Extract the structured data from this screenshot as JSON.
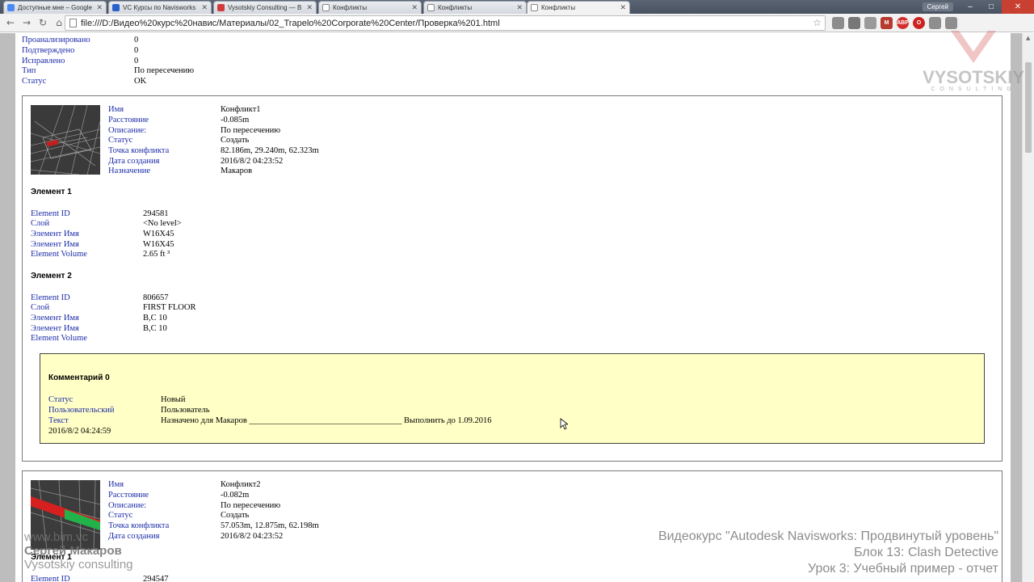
{
  "browser": {
    "tabs": [
      {
        "title": "Доступные мне – Google",
        "favicon_color": "#4a8af4",
        "active": false
      },
      {
        "title": "VC Курсы по Navisworks",
        "favicon_color": "#2a62c9",
        "active": false
      },
      {
        "title": "Vysotskiy Consulting — B",
        "favicon_color": "#d23b3b",
        "active": false
      },
      {
        "title": "Конфликты",
        "favicon_color": "#ffffff",
        "active": false
      },
      {
        "title": "Конфликты",
        "favicon_color": "#ffffff",
        "active": false
      },
      {
        "title": "Конфликты",
        "favicon_color": "#ffffff",
        "active": true
      }
    ],
    "user": "Сергей",
    "url": "file:///D:/Видео%20курс%20навис/Материалы/02_Trapelo%20Corporate%20Center/Проверка%201.html",
    "extensions": [
      {
        "name": "translate-icon",
        "color": "#8c8c8c",
        "label": ""
      },
      {
        "name": "extension-icon",
        "color": "#777777",
        "label": ""
      },
      {
        "name": "puzzle-icon",
        "color": "#9a9a9a",
        "label": ""
      },
      {
        "name": "gmail-icon",
        "color": "#b53a2f",
        "label": "M"
      },
      {
        "name": "adblock-icon",
        "color": "#d32f2f",
        "label": "ABP"
      },
      {
        "name": "opera-icon",
        "color": "#cc2222",
        "label": "O"
      },
      {
        "name": "apps-icon",
        "color": "#8e8e8e",
        "label": ""
      },
      {
        "name": "settings-icon",
        "color": "#8e8e8e",
        "label": ""
      }
    ]
  },
  "summary": {
    "rows": [
      {
        "key": "Проанализировано",
        "value": "0"
      },
      {
        "key": "Подтверждено",
        "value": "0"
      },
      {
        "key": "Исправлено",
        "value": "0"
      },
      {
        "key": "Тип",
        "value": "По пересечению"
      },
      {
        "key": "Статус",
        "value": "OK"
      }
    ]
  },
  "conflict1": {
    "props": [
      {
        "key": "Имя",
        "value": "Конфликт1"
      },
      {
        "key": "Расстояние",
        "value": "-0.085m"
      },
      {
        "key": "Описание:",
        "value": "По пересечению"
      },
      {
        "key": "Статус",
        "value": "Создать"
      },
      {
        "key": "Точка конфликта",
        "value": "82.186m,  29.240m,  62.323m"
      },
      {
        "key": "Дата создания",
        "value": "2016/8/2  04:23:52"
      },
      {
        "key": "Назначение",
        "value": "Макаров"
      }
    ],
    "element1": {
      "title": "Элемент 1",
      "rows": [
        {
          "key": "Element ID",
          "value": "294581"
        },
        {
          "key": "Слой",
          "value": "<No level>"
        },
        {
          "key": "Элемент Имя",
          "value": "W16X45"
        },
        {
          "key": "Элемент Имя",
          "value": "W16X45"
        },
        {
          "key": "Element Volume",
          "value": "2.65 ft ³"
        }
      ]
    },
    "element2": {
      "title": "Элемент 2",
      "rows": [
        {
          "key": "Element ID",
          "value": "806657"
        },
        {
          "key": "Слой",
          "value": "FIRST FLOOR"
        },
        {
          "key": "Элемент Имя",
          "value": "B,C 10"
        },
        {
          "key": "Элемент Имя",
          "value": "B,C 10"
        },
        {
          "key": "Element Volume",
          "value": ""
        }
      ]
    },
    "comment": {
      "title": "Комментарий 0",
      "rows": [
        {
          "key": "Статус",
          "value": "Новый"
        },
        {
          "key": "Пользовательский",
          "value": "Пользователь"
        },
        {
          "key": "Текст",
          "value": "Назначено для Макаров ____________________________________ Выполнить до 1.09.2016"
        }
      ],
      "date": "2016/8/2  04:24:59"
    }
  },
  "conflict2": {
    "props": [
      {
        "key": "Имя",
        "value": "Конфликт2"
      },
      {
        "key": "Расстояние",
        "value": "-0.082m"
      },
      {
        "key": "Описание:",
        "value": "По пересечению"
      },
      {
        "key": "Статус",
        "value": "Создать"
      },
      {
        "key": "Точка конфликта",
        "value": "57.053m,  12.875m,  62.198m"
      },
      {
        "key": "Дата создания",
        "value": "2016/8/2  04:23:52"
      }
    ],
    "element1": {
      "title": "Элемент 1",
      "rows": [
        {
          "key": "Element ID",
          "value": "294547"
        }
      ]
    }
  },
  "watermark": {
    "logo": "VYSOTSKIY",
    "logo_sub": "CONSULTING",
    "left_lines": [
      "www.bim.vc",
      "Сергей Макаров",
      "Vysotskiy consulting"
    ],
    "right_lines": [
      "Видеокурс \"Autodesk Navisworks: Продвинутый уровень\"",
      "Блок 13: Clash Detective",
      "Урок 3: Учебный пример - отчет"
    ]
  }
}
